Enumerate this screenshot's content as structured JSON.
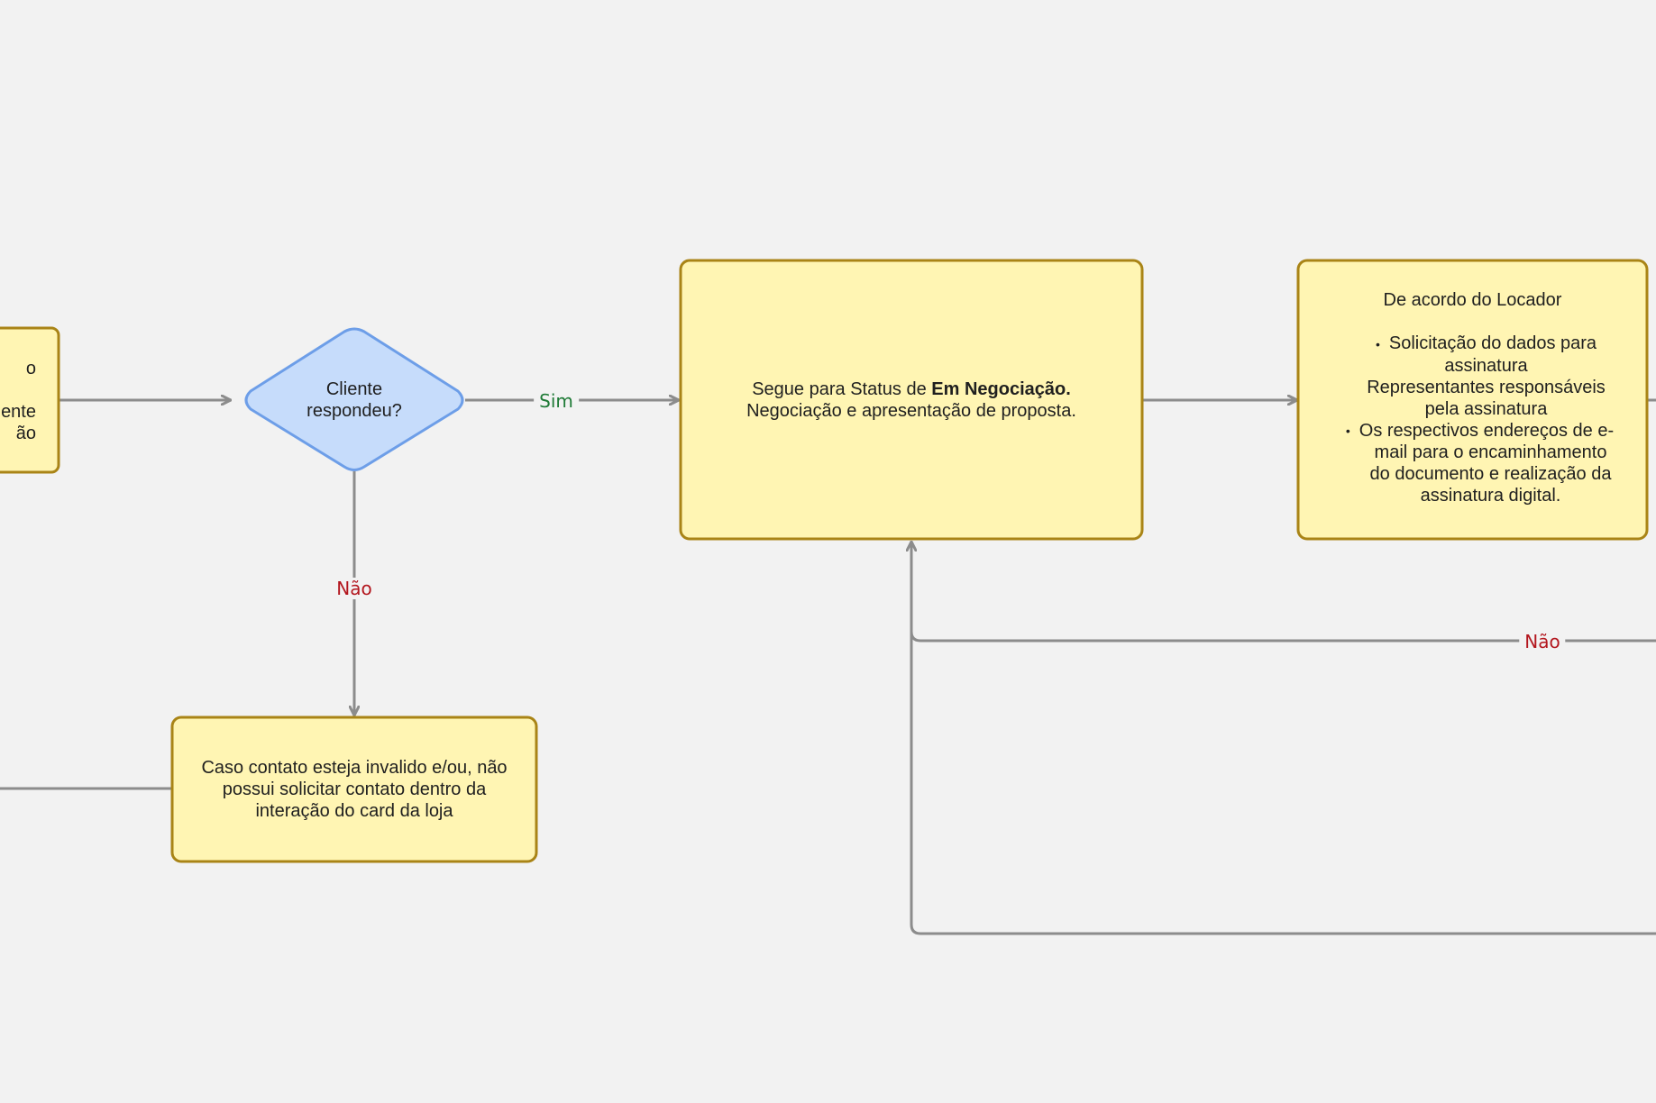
{
  "nodes": {
    "left_partial": {
      "line1": "o",
      "line2": "ente",
      "line3": "ão"
    },
    "decision": {
      "line1": "Cliente",
      "line2": "respondeu?"
    },
    "negociacao": {
      "prefix": "Segue para Status de ",
      "bold": "Em Negociação.",
      "line2": "Negociação e apresentação de proposta."
    },
    "locador": {
      "title": "De acordo do Locador",
      "bullet1_line1": "Solicitação do dados para",
      "bullet1_line2": "assinatura",
      "bullet1_line3": "Representantes responsáveis",
      "bullet1_line4": "pela assinatura",
      "bullet2_line1": "Os respectivos endereços de e-",
      "bullet2_line2": "mail para o encaminhamento",
      "bullet2_line3": "do documento e realização da",
      "bullet2_line4": "assinatura digital."
    },
    "invalido": {
      "line1": "Caso contato esteja invalido e/ou, não",
      "line2": "possui solicitar contato dentro da",
      "line3": "interação do card da loja"
    }
  },
  "edges": {
    "sim_label": "Sim",
    "nao_label_down": "Não",
    "nao_label_return": "Não"
  },
  "colors": {
    "process_fill": "#fff5b3",
    "process_stroke": "#a98416",
    "decision_fill": "#c6dcfb",
    "decision_stroke": "#6d9ee8",
    "edge": "#8c8c8c",
    "yes_text": "#1e7a36",
    "no_text": "#b3161e"
  }
}
